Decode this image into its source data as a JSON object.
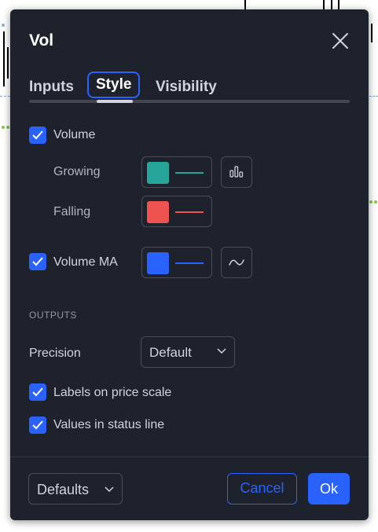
{
  "dialog": {
    "title": "Vol",
    "tabs": [
      {
        "label": "Inputs",
        "active": false
      },
      {
        "label": "Style",
        "active": true
      },
      {
        "label": "Visibility",
        "active": false
      }
    ]
  },
  "style": {
    "volume": {
      "label": "Volume",
      "checked": true
    },
    "growing": {
      "label": "Growing",
      "color": "#26a69a",
      "icon": "columns-icon"
    },
    "falling": {
      "label": "Falling",
      "color": "#ef5350"
    },
    "volume_ma": {
      "label": "Volume MA",
      "checked": true,
      "color": "#2962ff",
      "icon": "wave-line-icon"
    }
  },
  "outputs": {
    "heading": "OUTPUTS",
    "precision_label": "Precision",
    "precision_value": "Default",
    "labels_on_price_scale": {
      "label": "Labels on price scale",
      "checked": true
    },
    "values_in_status_line": {
      "label": "Values in status line",
      "checked": true
    }
  },
  "footer": {
    "defaults_label": "Defaults",
    "cancel_label": "Cancel",
    "ok_label": "Ok"
  },
  "colors": {
    "accent": "#2962ff",
    "dialog_bg": "#1e222d",
    "growing": "#26a69a",
    "falling": "#ef5350"
  }
}
